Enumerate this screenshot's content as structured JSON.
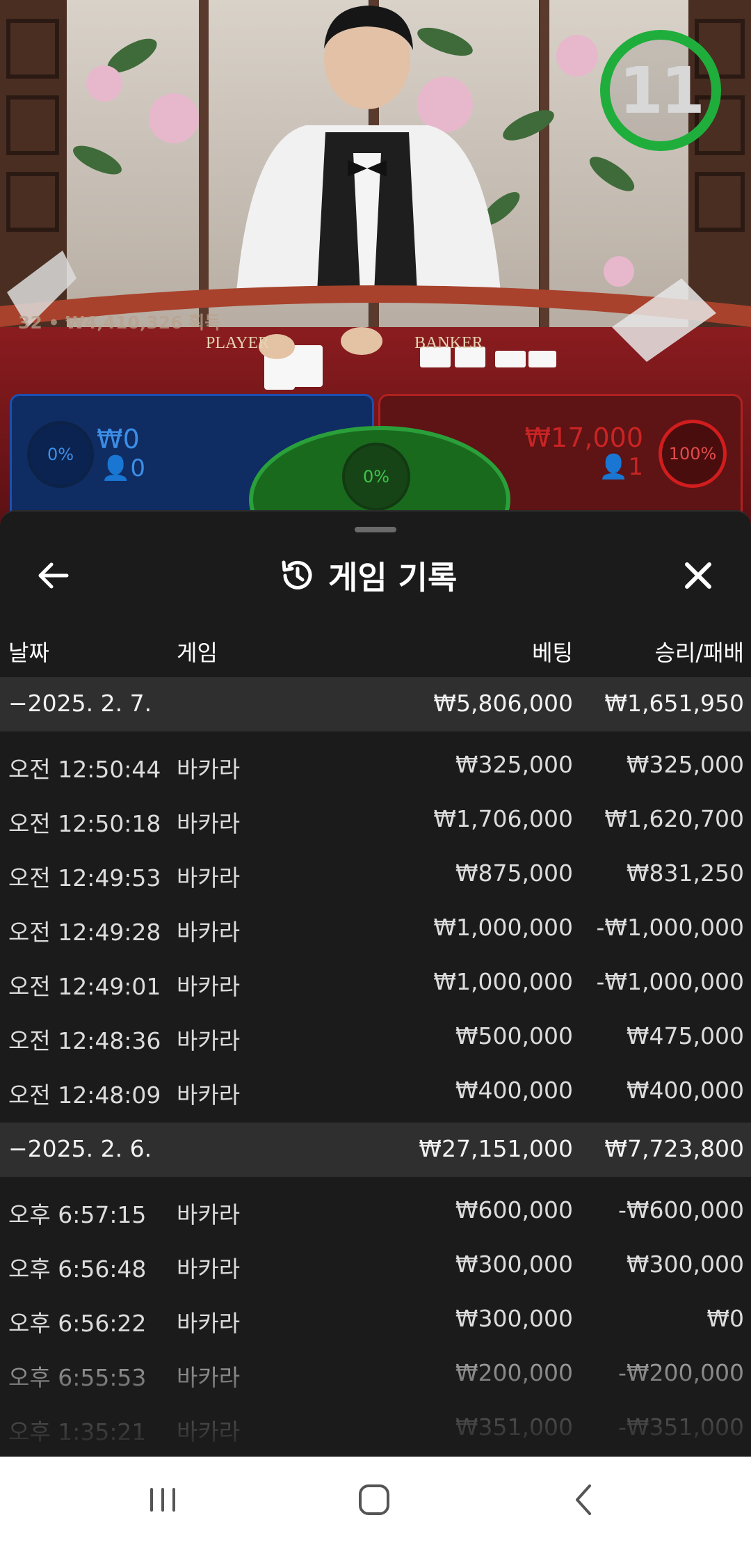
{
  "stream": {
    "countdown": "11",
    "win_caption": "32 • ₩4,410,326 획득",
    "table_labels": {
      "player": "PLAYER",
      "banker": "BANKER"
    }
  },
  "bet_zones": {
    "player": {
      "percent": "0%",
      "amount": "₩0",
      "players": "0"
    },
    "tie": {
      "percent": "0%"
    },
    "banker": {
      "percent": "100%",
      "amount": "₩17,000",
      "players": "1"
    }
  },
  "sheet": {
    "title": "게임 기록",
    "icons": {
      "back": "arrow-left-icon",
      "history": "history-icon",
      "close": "close-icon"
    },
    "columns": {
      "date": "날짜",
      "game": "게임",
      "bet": "베팅",
      "result": "승리/패배"
    },
    "groups": [
      {
        "date": "−2025. 2. 7.",
        "bet_total": "₩5,806,000",
        "result_total": "₩1,651,950",
        "rows": [
          {
            "time": "오전 12:50:44",
            "game": "바카라",
            "bet": "₩325,000",
            "result": "₩325,000"
          },
          {
            "time": "오전 12:50:18",
            "game": "바카라",
            "bet": "₩1,706,000",
            "result": "₩1,620,700"
          },
          {
            "time": "오전 12:49:53",
            "game": "바카라",
            "bet": "₩875,000",
            "result": "₩831,250"
          },
          {
            "time": "오전 12:49:28",
            "game": "바카라",
            "bet": "₩1,000,000",
            "result": "-₩1,000,000"
          },
          {
            "time": "오전 12:49:01",
            "game": "바카라",
            "bet": "₩1,000,000",
            "result": "-₩1,000,000"
          },
          {
            "time": "오전 12:48:36",
            "game": "바카라",
            "bet": "₩500,000",
            "result": "₩475,000"
          },
          {
            "time": "오전 12:48:09",
            "game": "바카라",
            "bet": "₩400,000",
            "result": "₩400,000"
          }
        ]
      },
      {
        "date": "−2025. 2. 6.",
        "bet_total": "₩27,151,000",
        "result_total": "₩7,723,800",
        "rows": [
          {
            "time": "오후 6:57:15",
            "game": "바카라",
            "bet": "₩600,000",
            "result": "-₩600,000"
          },
          {
            "time": "오후 6:56:48",
            "game": "바카라",
            "bet": "₩300,000",
            "result": "₩300,000"
          },
          {
            "time": "오후 6:56:22",
            "game": "바카라",
            "bet": "₩300,000",
            "result": "₩0"
          },
          {
            "time": "오후 6:55:53",
            "game": "바카라",
            "bet": "₩200,000",
            "result": "-₩200,000"
          },
          {
            "time": "오후 1:35:21",
            "game": "바카라",
            "bet": "₩351,000",
            "result": "-₩351,000"
          }
        ]
      }
    ]
  },
  "navbar": {
    "icons": [
      "recent-apps-icon",
      "home-icon",
      "back-icon"
    ]
  },
  "colors": {
    "sheet_bg": "#1b1b1b",
    "group_bg": "#2f2f2f",
    "player_blue": "#3b8ee6",
    "banker_red": "#c92424",
    "tie_green": "#2aa03a",
    "timer_green": "#1fae3c"
  }
}
